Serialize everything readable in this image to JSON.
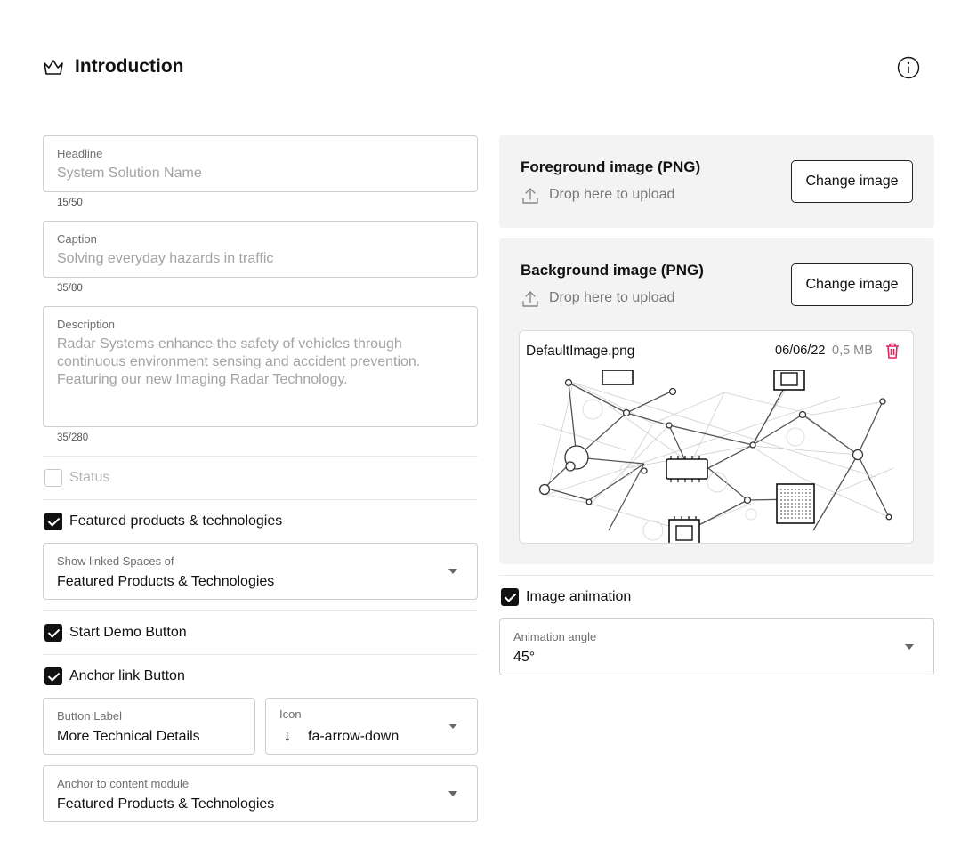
{
  "header": {
    "title": "Introduction",
    "crown_icon": "crown-icon",
    "info_icon": "info-icon"
  },
  "left": {
    "headline": {
      "label": "Headline",
      "placeholder": "System Solution Name",
      "counter": "15/50"
    },
    "caption": {
      "label": "Caption",
      "placeholder": "Solving everyday hazards in traffic",
      "counter": "35/80"
    },
    "description": {
      "label": "Description",
      "placeholder": "Radar Systems enhance the safety of vehicles through continuous environment sensing and accident prevention. Featuring our new Imaging Radar Technology.",
      "counter": "35/280"
    },
    "status": {
      "label": "Status",
      "checked": false,
      "disabled": true
    },
    "featured": {
      "label": "Featured products & technologies",
      "checked": true
    },
    "linked_spaces": {
      "label": "Show linked Spaces of",
      "value": "Featured Products & Technologies"
    },
    "start_demo": {
      "label": "Start Demo Button",
      "checked": true
    },
    "anchor_link": {
      "label": "Anchor link Button",
      "checked": true
    },
    "button_label": {
      "label": "Button Label",
      "value": "More Technical Details"
    },
    "icon_select": {
      "label": "Icon",
      "value": "fa-arrow-down",
      "glyph": "↓"
    },
    "anchor_module": {
      "label": "Anchor to content module",
      "value": "Featured Products & Technologies"
    }
  },
  "right": {
    "foreground": {
      "title": "Foreground image (PNG)",
      "drop_text": "Drop here to upload",
      "button": "Change image"
    },
    "background": {
      "title": "Background image (PNG)",
      "drop_text": "Drop here to upload",
      "button": "Change image",
      "file": {
        "name": "DefaultImage.png",
        "date": "06/06/22",
        "size": "0,5 MB"
      }
    },
    "image_animation": {
      "label": "Image animation",
      "checked": true
    },
    "animation_angle": {
      "label": "Animation angle",
      "value": "45°"
    }
  },
  "colors": {
    "accent": "#111111",
    "danger": "#e0245e",
    "panel_bg": "#f3f3f3",
    "border": "#cfcfcf"
  }
}
